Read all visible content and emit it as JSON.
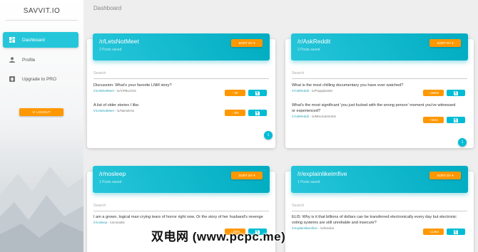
{
  "app": {
    "brand": "SAVVIT.IO",
    "page_title": "Dashboard"
  },
  "sidebar": {
    "items": [
      {
        "label": "Dashboard",
        "icon": "dashboard-icon",
        "active": true
      },
      {
        "label": "Profile",
        "icon": "person-icon",
        "active": false
      },
      {
        "label": "Upgrade to PRO",
        "icon": "upgrade-icon",
        "active": false
      }
    ],
    "logout_label": "LOGOUT"
  },
  "colors": {
    "accent": "#26c6da",
    "orange": "#ff9800",
    "cyan_button": "#00bcd4"
  },
  "cards": [
    {
      "title": "/r/LetsNotMeet",
      "subtitle": "2 Posts saved",
      "sort_label": "SORT BY ▾",
      "search_placeholder": "Search",
      "page": "1",
      "posts": [
        {
          "title": "Discussion: What's your favorite LNM story?",
          "meta_sub": "/r/LetsNotMeet",
          "meta_user": " - /u/VIPBLOGS",
          "upvotes": "↑ 50",
          "save_icon": "save-icon"
        },
        {
          "title": "A list of older stories I like.",
          "meta_sub": "/r/LetsNotMeet",
          "meta_user": " - /u/Nameless",
          "upvotes": "↑ 400",
          "save_icon": "save-icon"
        }
      ]
    },
    {
      "title": "/r/AskReddit",
      "subtitle": "2 Posts saved",
      "sort_label": "SORT BY ▾",
      "search_placeholder": "Search",
      "page": "1",
      "posts": [
        {
          "title": "What is the most chilling documentary you have ever watched?",
          "meta_sub": "/r/AskReddit",
          "meta_user": " - /u/Poppylander",
          "upvotes": "↑ 35000",
          "save_icon": "save-icon"
        },
        {
          "title": "What's the most significant 'you just fucked with the wrong person' moment you've witnessed or experienced?",
          "meta_sub": "/r/AskReddit",
          "meta_user": " - /u/MiscreantArtist",
          "upvotes": "↑ 5444",
          "save_icon": "save-icon"
        }
      ]
    },
    {
      "title": "/r/nosleep",
      "subtitle": "1 Posts saved",
      "sort_label": "SORT BY ▾",
      "search_placeholder": "Search",
      "posts": [
        {
          "title": "I am a grown, logical man crying tears of horror right now. Or the story of her husband's revenge",
          "meta_sub": "/r/nosleep",
          "meta_user": " - /u/mmarkk",
          "upvotes": "↑ 2000",
          "save_icon": "save-icon"
        }
      ]
    },
    {
      "title": "/r/explainlikeimfive",
      "subtitle": "1 Posts saved",
      "sort_label": "SORT BY ▾",
      "search_placeholder": "Search",
      "posts": [
        {
          "title": "ELI5: Why is it that billions of dollars can be transferred electronically every day but electronic voting systems are still unreliable and insecure?",
          "meta_sub": "/r/explainlikeimfive",
          "meta_user": " - /u/tmedoe",
          "upvotes": "↑ 11454",
          "save_icon": "save-icon"
        }
      ]
    }
  ],
  "watermark": "双电网 (www.pcpc.me)"
}
